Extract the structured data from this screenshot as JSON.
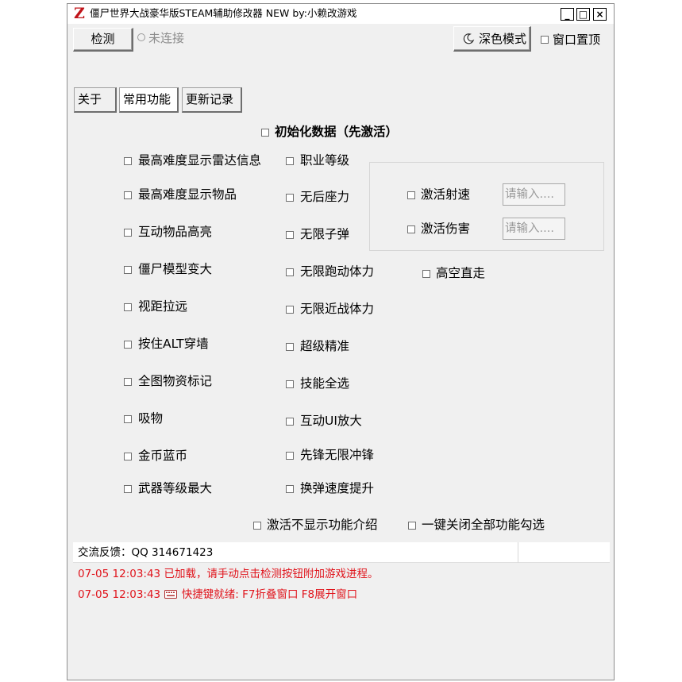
{
  "window": {
    "title": "僵尸世界大战豪华版STEAM辅助修改器 NEW   by:小赖改游戏",
    "icon_letter": "Z",
    "buttons": {
      "minimize": "_",
      "maximize": "□",
      "close": "×"
    }
  },
  "toolbar": {
    "detect_label": "检测",
    "status_text": "未连接",
    "dark_mode_label": "深色模式",
    "topmost_label": "窗口置顶"
  },
  "tabs": [
    {
      "label": "关于",
      "active": false
    },
    {
      "label": "常用功能",
      "active": true
    },
    {
      "label": "更新记录",
      "active": false
    }
  ],
  "init_label": "初始化数据（先激活）",
  "features": {
    "col1": [
      "最高难度显示雷达信息",
      "最高难度显示物品",
      "互动物品高亮",
      "僵尸模型变大",
      "视距拉远",
      "按住ALT穿墙",
      "全图物资标记",
      "吸物",
      "金币蓝币",
      "武器等级最大"
    ],
    "col2": [
      "职业等级",
      "无后座力",
      "无限子弹",
      "无限跑动体力",
      "无限近战体力",
      "超级精准",
      "技能全选",
      "互动UI放大",
      "先锋无限冲锋",
      "换弹速度提升"
    ],
    "fly": "高空直走"
  },
  "group": {
    "fire_rate_label": "激活射速",
    "fire_rate_placeholder": "请输入....",
    "damage_label": "激活伤害",
    "damage_placeholder": "请输入...."
  },
  "bottom_options": {
    "hide_intro": "激活不显示功能介绍",
    "close_all": "一键关闭全部功能勾选"
  },
  "log": {
    "header": "交流反馈：QQ 314671423",
    "entries": [
      {
        "time": "07-05 12:03:43",
        "text": "已加载，请手动点击检测按钮附加游戏进程。"
      },
      {
        "time": "07-05 12:03:43",
        "icon": "keyboard-icon",
        "text": "快捷键就绪: F7折叠窗口  F8展开窗口"
      }
    ]
  },
  "colors": {
    "accent_red": "#e0141c",
    "window_bg": "#f0f0f0",
    "icon_red": "#c0141a"
  }
}
